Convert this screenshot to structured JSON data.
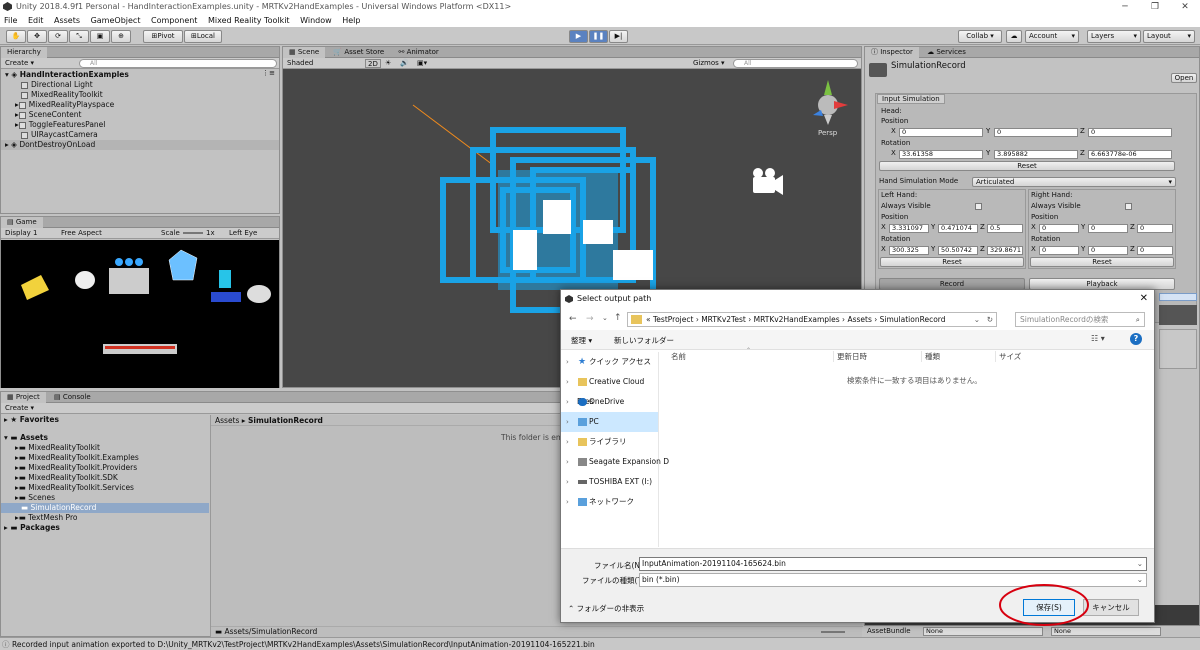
{
  "window": {
    "title": "Unity 2018.4.9f1 Personal - HandInteractionExamples.unity - MRTKv2HandExamples - Universal Windows Platform <DX11>",
    "controls": [
      "─",
      "❐",
      "✕"
    ]
  },
  "menu": [
    "File",
    "Edit",
    "Assets",
    "GameObject",
    "Component",
    "Mixed Reality Toolkit",
    "Window",
    "Help"
  ],
  "toolbar": {
    "pivot": "Pivot",
    "local": "Local",
    "collab": "Collab ▾",
    "account": "Account",
    "layers": "Layers",
    "layout": "Layout"
  },
  "hierarchy": {
    "tab": "Hierarchy",
    "create": "Create ▾",
    "search": "All",
    "root": "HandInteractionExamples",
    "items": [
      "Directional Light",
      "MixedRealityToolkit",
      "MixedRealityPlayspace",
      "SceneContent",
      "ToggleFeaturesPanel",
      "UIRaycastCamera"
    ],
    "second_root": "DontDestroyOnLoad"
  },
  "scene": {
    "tabs": [
      "Scene",
      "Asset Store",
      "Animator"
    ],
    "shading": "Shaded",
    "mode": "2D",
    "gizmos": "Gizmos ▾",
    "search": "All",
    "persp": "Persp"
  },
  "game": {
    "tab": "Game",
    "display": "Display 1",
    "aspect": "Free Aspect",
    "scale": "Scale",
    "scale_val": "1x",
    "eye": "Left Eye"
  },
  "project": {
    "tabs": [
      "Project",
      "Console"
    ],
    "create": "Create ▾",
    "favorites": "Favorites",
    "assets": "Assets",
    "folders": [
      "MixedRealityToolkit",
      "MixedRealityToolkit.Examples",
      "MixedRealityToolkit.Providers",
      "MixedRealityToolkit.SDK",
      "MixedRealityToolkit.Services",
      "Scenes",
      "SimulationRecord",
      "TextMesh Pro"
    ],
    "packages": "Packages",
    "breadcrumb_root": "Assets",
    "breadcrumb_leaf": "SimulationRecord",
    "empty": "This folder is em",
    "footer_path": "Assets/SimulationRecord"
  },
  "inspector": {
    "tabs": [
      "Inspector",
      "Services"
    ],
    "object": "SimulationRecord",
    "open": "Open",
    "section": "Input Simulation",
    "head": "Head:",
    "position": "Position",
    "rotation": "Rotation",
    "head_pos": {
      "x": "0",
      "y": "0",
      "z": "0"
    },
    "head_rot": {
      "x": "33.61358",
      "y": "3.895882",
      "z": "6.663778e-06"
    },
    "reset": "Reset",
    "mode_label": "Hand Simulation Mode",
    "mode_value": "Articulated",
    "left_hand": "Left Hand:",
    "right_hand": "Right Hand:",
    "always_visible": "Always Visible",
    "left_pos": {
      "x": "3.331097",
      "y": "0.471074",
      "z": "0.5"
    },
    "left_rot": {
      "x": "300.325",
      "y": "50.50742",
      "z": "329.8671"
    },
    "right_pos": {
      "x": "0",
      "y": "0",
      "z": "0"
    },
    "right_rot": {
      "x": "0",
      "y": "0",
      "z": "0"
    },
    "record": "Record",
    "playback": "Playback",
    "assetbundle": "AssetBundle",
    "none1": "None",
    "none2": "None"
  },
  "dialog": {
    "title": "Select output path",
    "crumbs": [
      "«",
      "TestProject",
      "›",
      "MRTKv2Test",
      "›",
      "MRTKv2HandExamples",
      "›",
      "Assets",
      "›",
      "SimulationRecord"
    ],
    "search_placeholder": "SimulationRecordの検索",
    "organize": "整理 ▾",
    "new_folder": "新しいフォルダー",
    "nav": [
      {
        "label": "クイック アクセス",
        "icon": "star-icon"
      },
      {
        "label": "Creative Cloud Files",
        "icon": "cloud-icon"
      },
      {
        "label": "OneDrive",
        "icon": "onedrive-icon"
      },
      {
        "label": "PC",
        "icon": "pc-icon"
      },
      {
        "label": "ライブラリ",
        "icon": "library-icon"
      },
      {
        "label": "Seagate Expansion D",
        "icon": "drive-icon"
      },
      {
        "label": "TOSHIBA EXT (I:)",
        "icon": "drive-icon"
      },
      {
        "label": "ネットワーク",
        "icon": "network-icon"
      }
    ],
    "columns": [
      "名前",
      "更新日時",
      "種類",
      "サイズ"
    ],
    "empty": "検索条件に一致する項目はありません。",
    "filename_label": "ファイル名(N):",
    "filename": "InputAnimation-20191104-165624.bin",
    "filetype_label": "ファイルの種類(T):",
    "filetype": "bin (*.bin)",
    "hide_folders": "フォルダーの非表示",
    "save": "保存(S)",
    "cancel": "キャンセル",
    "highlight_color": "#d7000f"
  },
  "console_msg": "Recorded input animation exported to D:\\Unity_MRTKv2\\TestProject\\MRTKv2HandExamples\\Assets\\SimulationRecord\\InputAnimation-20191104-165221.bin"
}
